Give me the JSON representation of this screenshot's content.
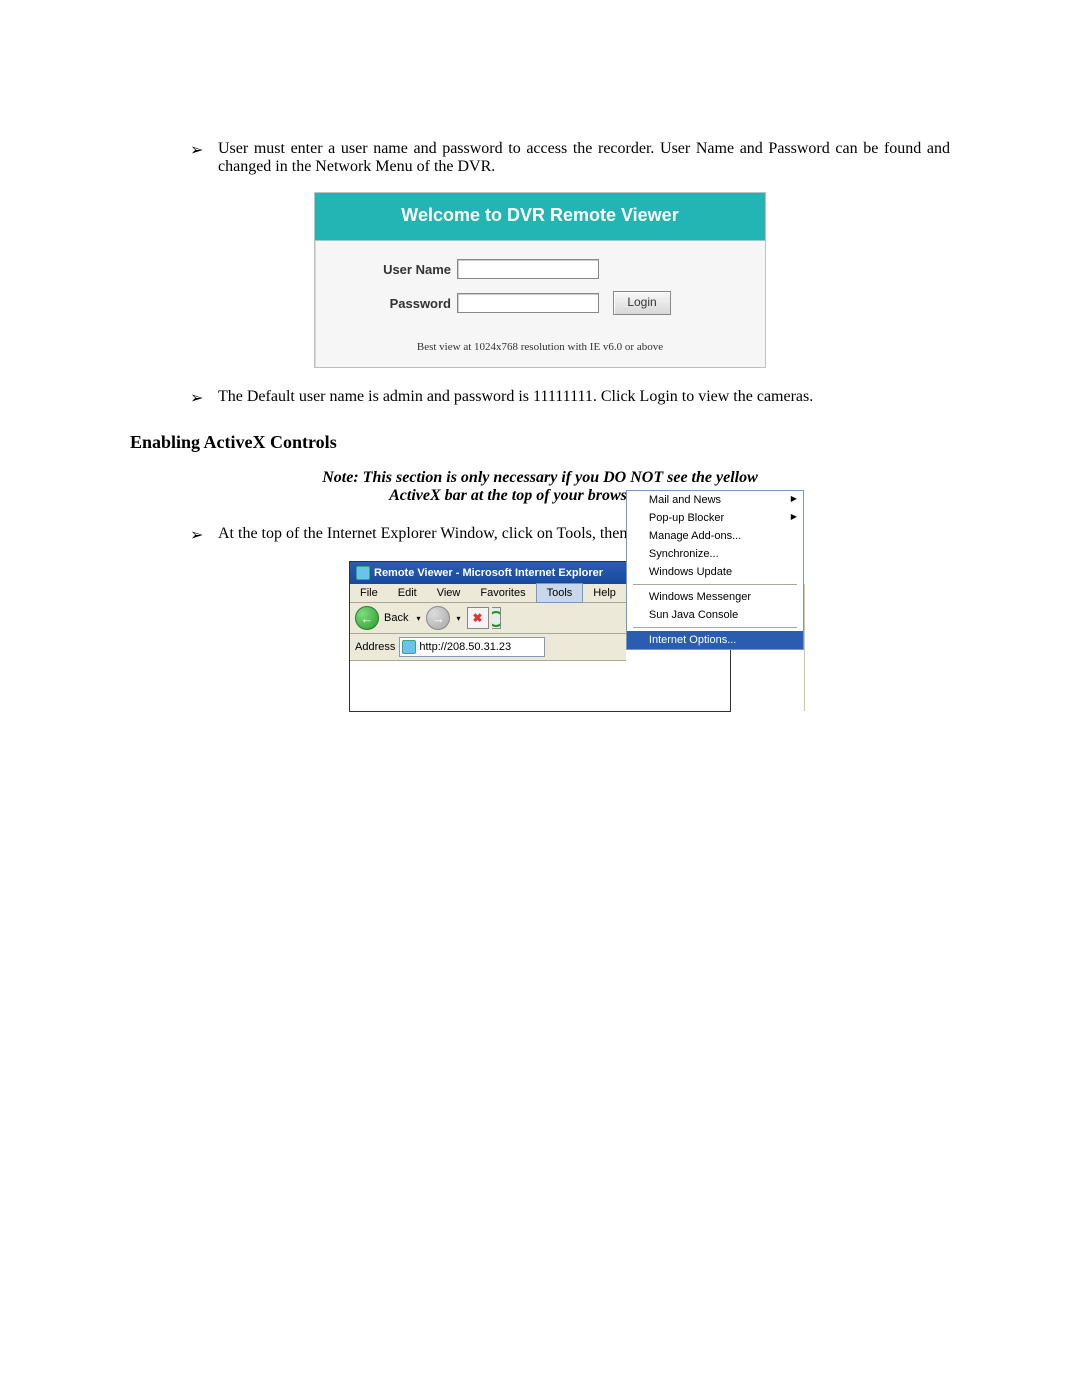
{
  "bullets": {
    "b1": "User must enter a user name and password to access the recorder. User Name and Password can be found and changed in the Network Menu of the DVR.",
    "b2": "The Default user name is admin and password is 11111111. Click Login to view the cameras.",
    "b3": "At the top of the Internet Explorer Window, click on Tools, then select Internet Options."
  },
  "login": {
    "title": "Welcome to DVR Remote Viewer",
    "user_label": "User Name",
    "pass_label": "Password",
    "button": "Login",
    "footer": "Best view at 1024x768 resolution with IE v6.0 or above"
  },
  "section_heading": "Enabling ActiveX Controls",
  "note": {
    "line1": "Note: This section is only necessary if you DO NOT see the yellow",
    "line2": "ActiveX bar at the top of your browser screen."
  },
  "ie": {
    "title": "Remote Viewer - Microsoft Internet Explorer",
    "menu": {
      "file": "File",
      "edit": "Edit",
      "view": "View",
      "fav": "Favorites",
      "tools": "Tools",
      "help": "Help"
    },
    "back": "Back",
    "addr_label": "Address",
    "addr_url": "http://208.50.31.23",
    "drop": {
      "mail": "Mail and News",
      "popup": "Pop-up Blocker",
      "addons": "Manage Add-ons...",
      "sync": "Synchronize...",
      "update": "Windows Update",
      "msgr": "Windows Messenger",
      "java": "Sun Java Console",
      "iopts": "Internet Options..."
    }
  },
  "glyph": {
    "bullet": "➢",
    "dropdown": "▾",
    "back": "←",
    "fwd": "→",
    "x": "✖"
  }
}
